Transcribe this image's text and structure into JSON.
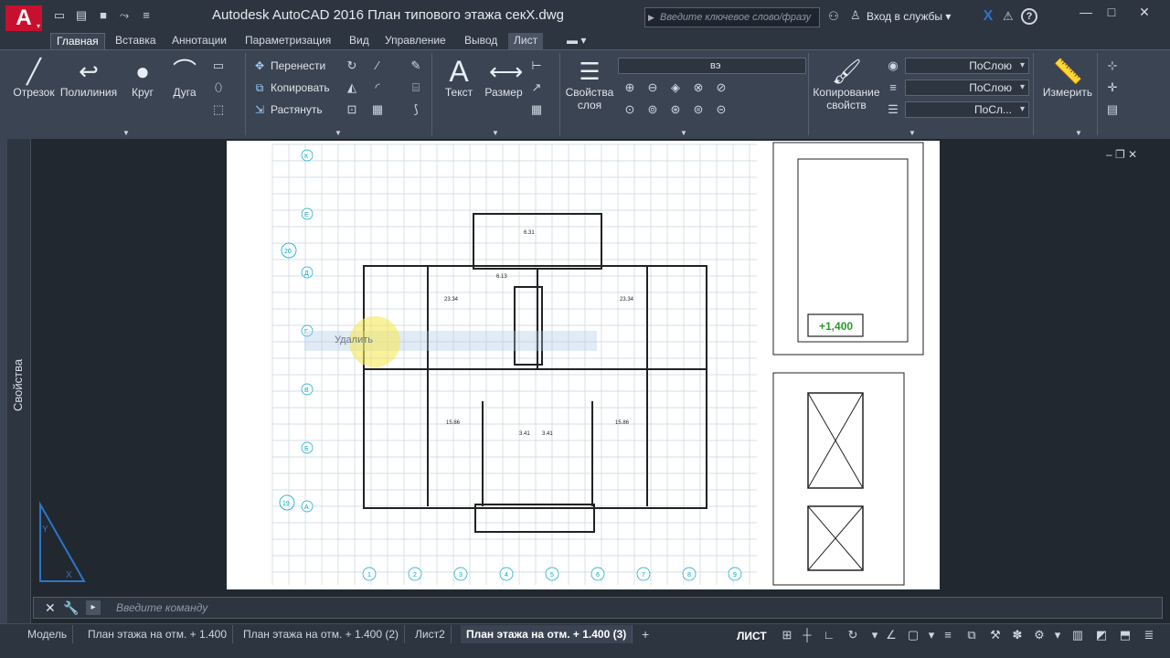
{
  "title_bar": {
    "title": "Autodesk AutoCAD 2016     План типового этажа секХ.dwg",
    "search_placeholder": "Введите ключевое слово/фразу",
    "signin": "Вход в службы ▾",
    "app_logo": "A"
  },
  "ribbon_tabs": [
    "Главная",
    "Вставка",
    "Аннотации",
    "Параметризация",
    "Вид",
    "Управление",
    "Вывод",
    "Лист"
  ],
  "ribbon": {
    "line": "Отрезок",
    "polyline": "Полилиния",
    "circle": "Круг",
    "arc": "Дуга",
    "move": "Перенести",
    "copy": "Копировать",
    "stretch": "Растянуть",
    "text": "Текст",
    "dimension": "Размер",
    "layer_props_1": "Свойства",
    "layer_props_2": "слоя",
    "copy_props_1": "Копирование",
    "copy_props_2": "свойств",
    "measure": "Измерить",
    "layer_value": "вэ",
    "color_value": "ПоСлою",
    "linetype_value": "ПоСлою",
    "lineweight_value": "ПоСл..."
  },
  "sidebar": {
    "properties": "Свойства"
  },
  "canvas": {
    "cursor_hint": "Удалить",
    "level_mark": "+1,400",
    "grid_letters": [
      "К",
      "Е",
      "Д",
      "Г",
      "В",
      "Б",
      "А"
    ],
    "grid_numbers": [
      "1",
      "2",
      "3",
      "4",
      "5",
      "6",
      "7",
      "8",
      "9"
    ],
    "bubble_20": "20",
    "bubble_19": "19"
  },
  "command_line": {
    "placeholder": "Введите команду"
  },
  "status_bar": {
    "tabs": [
      "Модель",
      "План этажа на отм. + 1.400",
      "План этажа на отм. + 1.400 (2)",
      "Лист2",
      "План этажа на отм. + 1.400 (3)"
    ],
    "active_tab": "План этажа на отм. + 1.400 (3)",
    "space": "ЛИСТ"
  },
  "colors": {
    "accent": "#c8102e",
    "cad_cyan": "#00a6c8",
    "highlight": "#f5e85a"
  }
}
